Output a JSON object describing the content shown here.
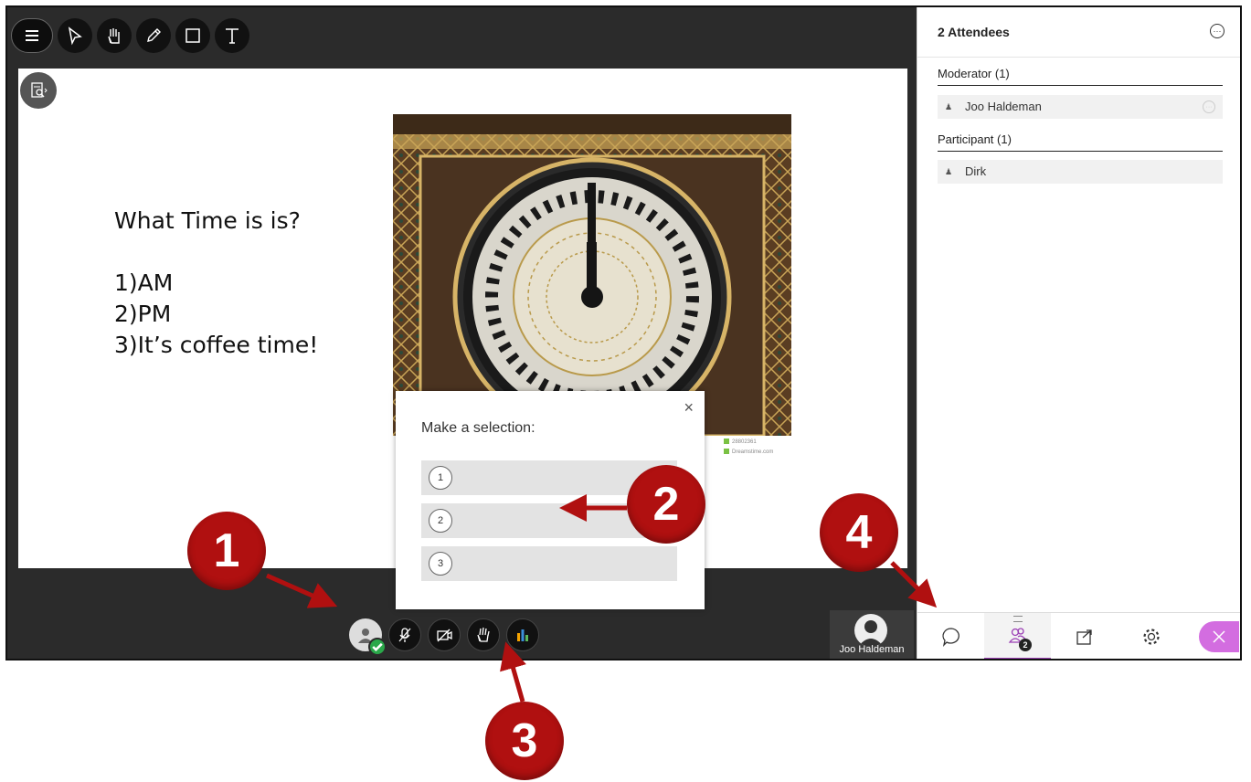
{
  "slide": {
    "question": "What Time is is?",
    "options": [
      "1)AM",
      "2)PM",
      "3)It’s coffee time!"
    ],
    "credit_id": "28802361",
    "credit_site": "Dreamstime.com"
  },
  "poll": {
    "title": "Make a selection:",
    "close_label": "×",
    "options": [
      "1",
      "2",
      "3"
    ]
  },
  "video_tile": {
    "name": "Joo Haldeman"
  },
  "panel": {
    "title": "2 Attendees",
    "moderator_header": "Moderator (1)",
    "moderator_name": "Joo Haldeman",
    "participant_header": "Participant (1)",
    "participant_name": "Dirk",
    "attendee_count": "2"
  },
  "callouts": [
    "1",
    "2",
    "3",
    "4"
  ],
  "colors": {
    "accent": "#9b3fb5",
    "leave": "#d36de0",
    "callout": "#b01010",
    "status": "#2aa84a"
  }
}
